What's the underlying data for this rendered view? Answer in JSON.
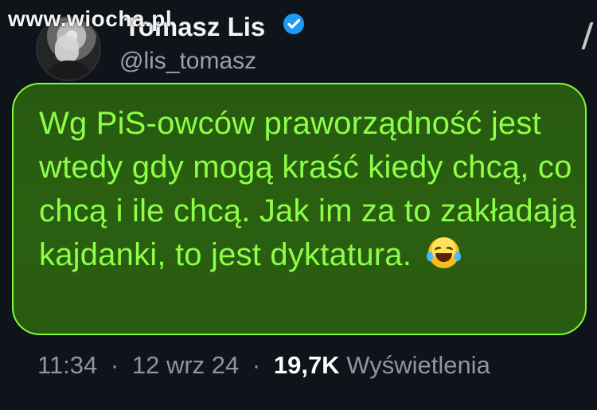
{
  "watermark": {
    "text": "www.wiocha.pl"
  },
  "profile": {
    "name": "Tomasz Lis",
    "handle": "@lis_tomasz",
    "verified": true,
    "avatar": "avatar-photo"
  },
  "tweet": {
    "text": "Wg PiS-owców praworządność jest wtedy gdy mogą kraść  kiedy chcą, co chcą i ile chcą. Jak im za to zakładają kajdanki, to jest dyktatura.",
    "emoji": "😂"
  },
  "meta": {
    "time": "11:34",
    "separator": "·",
    "date": "12 wrz 24",
    "views": "19,7K",
    "views_label": "Wyświetlenia"
  },
  "colors": {
    "background": "#0f141a",
    "bubble_border": "#7cff35",
    "bubble_fill": "#295b10",
    "tweet_text": "#8cff46",
    "verified_badge": "#1d9bf0",
    "muted_text": "#8f969e"
  },
  "icons": {
    "verified": "verified-icon",
    "more": "more-icon",
    "emoji": "laughing-crying-emoji-icon"
  }
}
